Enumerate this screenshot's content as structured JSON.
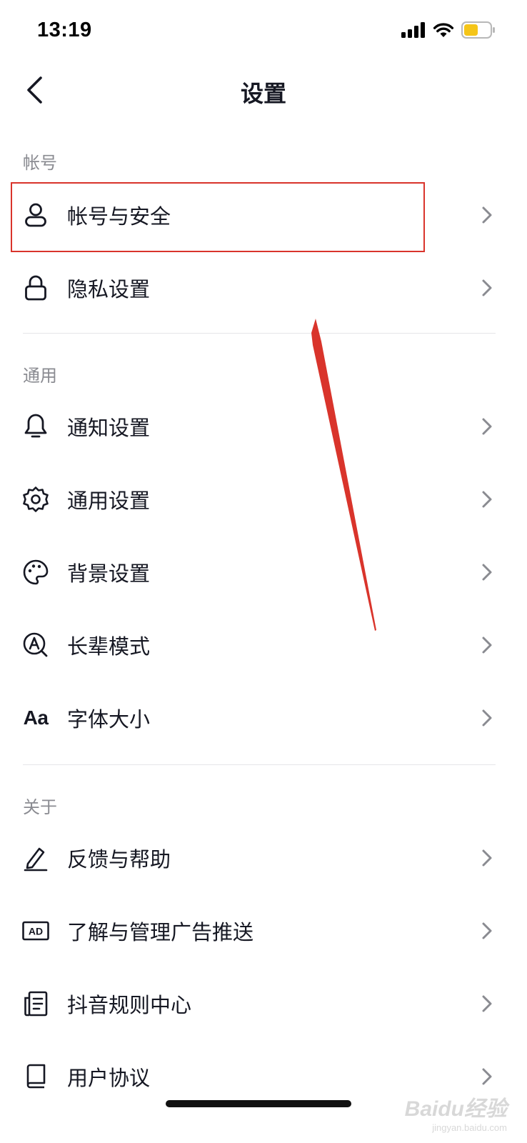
{
  "status_bar": {
    "time": "13:19",
    "icons": [
      "signal-icon",
      "wifi-icon",
      "battery-icon"
    ],
    "battery_color": "#f5c518"
  },
  "nav": {
    "title": "设置",
    "back_icon": "chevron-left-icon"
  },
  "sections": [
    {
      "header": "帐号",
      "items": [
        {
          "label": "帐号与安全",
          "icon": "user-icon"
        },
        {
          "label": "隐私设置",
          "icon": "lock-icon"
        }
      ]
    },
    {
      "header": "通用",
      "items": [
        {
          "label": "通知设置",
          "icon": "bell-icon"
        },
        {
          "label": "通用设置",
          "icon": "gear-icon"
        },
        {
          "label": "背景设置",
          "icon": "palette-icon"
        },
        {
          "label": "长辈模式",
          "icon": "elder-mode-icon"
        },
        {
          "label": "字体大小",
          "icon": "font-size-icon",
          "icon_text": "Aa"
        }
      ]
    },
    {
      "header": "关于",
      "items": [
        {
          "label": "反馈与帮助",
          "icon": "pencil-icon"
        },
        {
          "label": "了解与管理广告推送",
          "icon": "ad-icon",
          "icon_text": "AD"
        },
        {
          "label": "抖音规则中心",
          "icon": "document-icon"
        },
        {
          "label": "用户协议",
          "icon": "book-icon"
        }
      ]
    }
  ],
  "annotation": {
    "highlight_color": "#d9342b",
    "highlighted_item": "帐号与安全"
  },
  "watermark": {
    "brand": "Baidu经验",
    "sub": "jingyan.baidu.com"
  }
}
